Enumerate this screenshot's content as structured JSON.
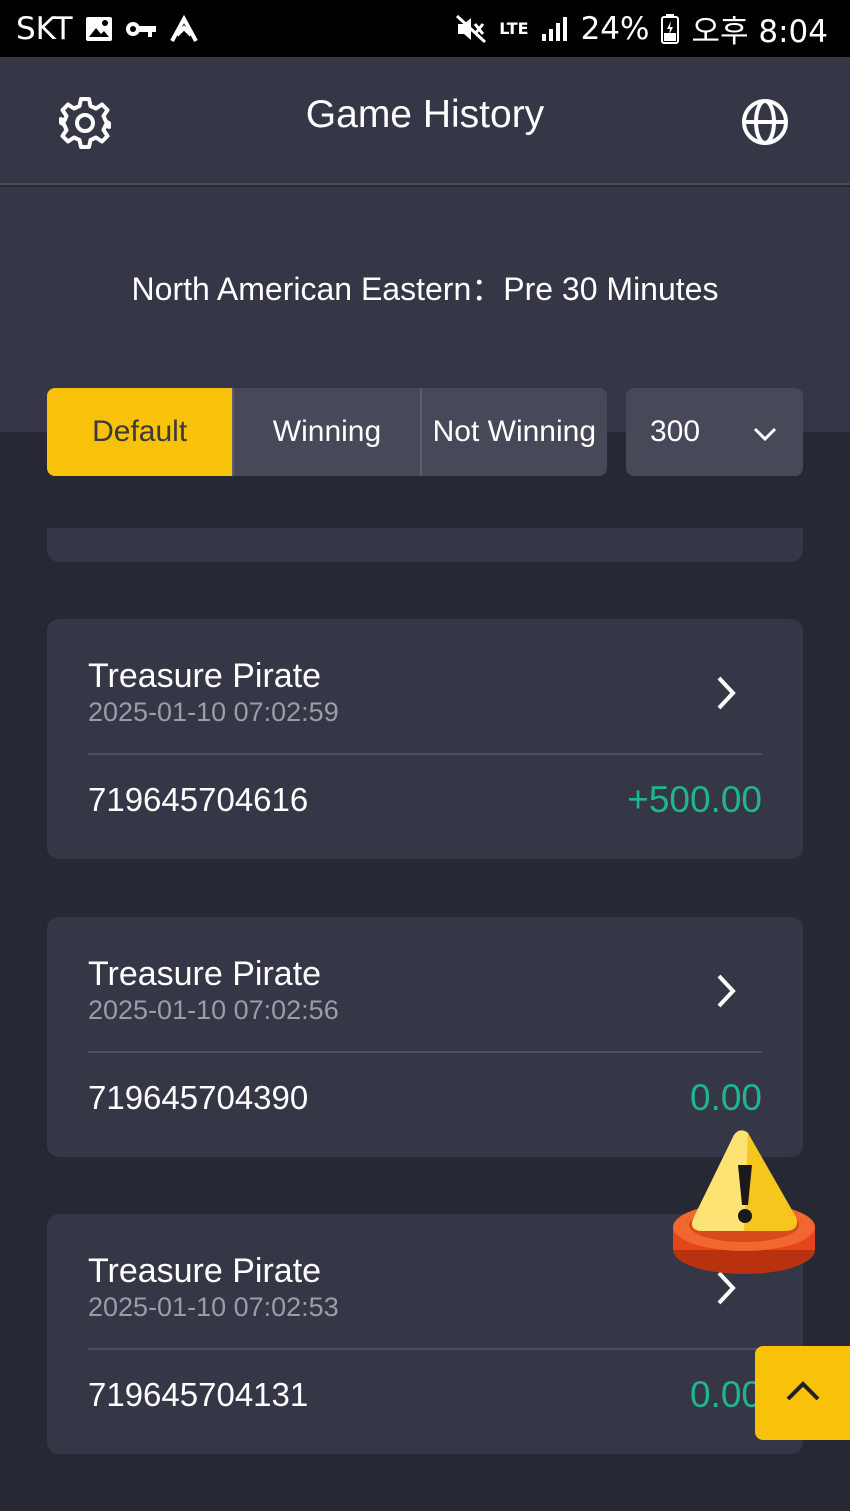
{
  "status_bar": {
    "carrier": "SKT",
    "network": "LTE",
    "battery": "24%",
    "time": "오후 8:04",
    "icons": [
      "gallery-icon",
      "vpn-key-icon",
      "upload-icon",
      "mute-icon",
      "lte-icon",
      "signal-icon",
      "battery-icon"
    ]
  },
  "header": {
    "title": "Game History",
    "left_icon": "gear-icon",
    "right_icon": "globe-icon"
  },
  "timezone_label": "North American Eastern：Pre 30 Minutes",
  "filter": {
    "tabs": [
      {
        "label": "Default",
        "active": true
      },
      {
        "label": "Winning",
        "active": false
      },
      {
        "label": "Not Winning",
        "active": false
      }
    ],
    "count_select": {
      "value": "300",
      "icon": "chevron-down-icon"
    }
  },
  "records": [
    {
      "game": "Treasure Pirate",
      "time": "2025-01-10 07:02:59",
      "id": "719645704616",
      "amount": "+500.00"
    },
    {
      "game": "Treasure Pirate",
      "time": "2025-01-10 07:02:56",
      "id": "719645704390",
      "amount": "0.00"
    },
    {
      "game": "Treasure Pirate",
      "time": "2025-01-10 07:02:53",
      "id": "719645704131",
      "amount": "0.00"
    }
  ],
  "colors": {
    "accent": "#f8c10a",
    "amount": "#1fb58f",
    "background": "#262834",
    "card": "#353746"
  },
  "floating": {
    "warning_icon": "warning-icon",
    "scroll_top_icon": "chevron-up-icon"
  }
}
